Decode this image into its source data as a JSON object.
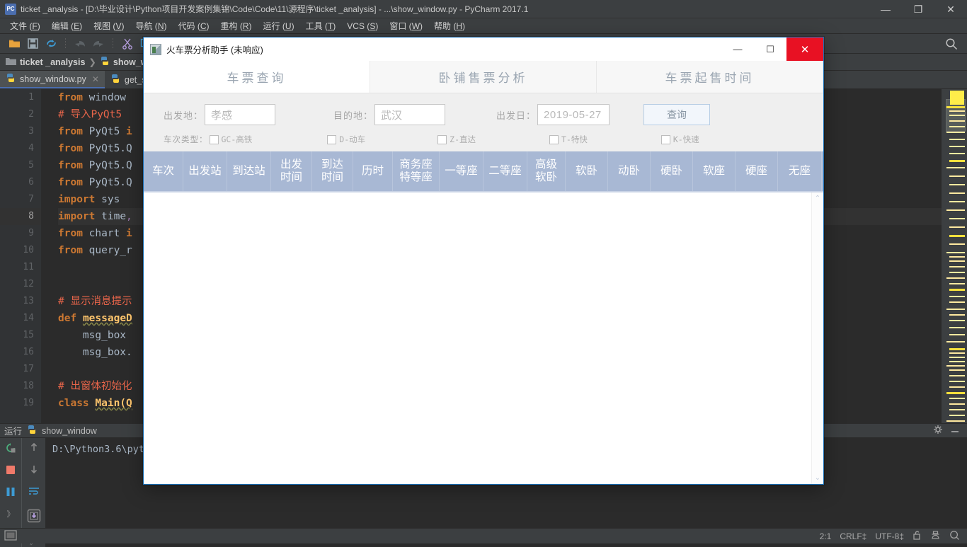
{
  "ide": {
    "titlebar": {
      "icon": "pycharm-icon",
      "title": "ticket _analysis - [D:\\毕业设计\\Python项目开发案例集锦\\Code\\Code\\11\\源程序\\ticket _analysis] - ...\\show_window.py - PyCharm 2017.1",
      "minimize": "—",
      "maximize": "❐",
      "close": "✕"
    },
    "menu": [
      {
        "label": "文件",
        "mnemonic": "F"
      },
      {
        "label": "编辑",
        "mnemonic": "E"
      },
      {
        "label": "视图",
        "mnemonic": "V"
      },
      {
        "label": "导航",
        "mnemonic": "N"
      },
      {
        "label": "代码",
        "mnemonic": "C"
      },
      {
        "label": "重构",
        "mnemonic": "R"
      },
      {
        "label": "运行",
        "mnemonic": "U"
      },
      {
        "label": "工具",
        "mnemonic": "T"
      },
      {
        "label": "VCS",
        "mnemonic": "S"
      },
      {
        "label": "窗口",
        "mnemonic": "W"
      },
      {
        "label": "帮助",
        "mnemonic": "H"
      }
    ],
    "toolbar": {
      "icons": [
        "open-folder-icon",
        "save-icon",
        "sync-icon",
        "undo-icon",
        "redo-icon",
        "cut-icon",
        "copy-icon",
        "paste-icon"
      ],
      "search_icon": "search-icon"
    },
    "breadcrumb": {
      "project": "ticket _analysis",
      "separator": "❯",
      "file": "show_wi"
    },
    "editor_tabs": [
      {
        "label": "show_window.py",
        "active": true,
        "close": "✕"
      },
      {
        "label": "get_s",
        "active": false,
        "close": ""
      }
    ],
    "code_lines": [
      {
        "n": "1",
        "html": "<span class='kw'>from</span> <span class='id'>window</span>"
      },
      {
        "n": "2",
        "html": "<span class='cmt2'># 导入PyQt5</span>"
      },
      {
        "n": "3",
        "html": "<span class='kw'>from</span> <span class='id'>PyQt5</span> <span class='kw'>i</span>"
      },
      {
        "n": "4",
        "html": "<span class='kw'>from</span> <span class='id'>PyQt5.Q</span>"
      },
      {
        "n": "5",
        "html": "<span class='kw'>from</span> <span class='id'>PyQt5.Q</span>"
      },
      {
        "n": "6",
        "html": "<span class='kw'>from</span> <span class='id'>PyQt5.Q</span>"
      },
      {
        "n": "7",
        "html": "<span class='kw'>import</span> <span class='id'>sys</span>"
      },
      {
        "n": "8",
        "html": "<span class='kw'>import</span> <span class='id'>time</span><span class='var'>,</span>",
        "hl": true
      },
      {
        "n": "9",
        "html": "<span class='kw'>from</span> <span class='id'>chart</span> <span class='kw'>i</span>"
      },
      {
        "n": "10",
        "html": "<span class='kw'>from</span> <span class='id'>query_r</span>"
      },
      {
        "n": "11",
        "html": ""
      },
      {
        "n": "12",
        "html": ""
      },
      {
        "n": "13",
        "html": "<span class='cmt2'># 显示消息提示</span>"
      },
      {
        "n": "14",
        "html": "<span class='kw'>def</span> <span class='fn'>messageD</span>"
      },
      {
        "n": "15",
        "html": "    <span class='id'>msg_box</span>"
      },
      {
        "n": "16",
        "html": "    <span class='id'>msg_box.</span>"
      },
      {
        "n": "17",
        "html": ""
      },
      {
        "n": "18",
        "html": "<span class='cmt2'># 出窗体初始化</span>"
      },
      {
        "n": "19",
        "html": "<span class='kw'>class</span> <span class='fn'>Main(Q</span>"
      }
    ],
    "run_window": {
      "label": "运行",
      "config_name": "show_window",
      "console_text": "D:\\Python3.6\\pyt",
      "side_icons": [
        "rerun-icon",
        "stop-icon",
        "pause-icon",
        "expand-all-icon",
        "scroll-up-icon",
        "scroll-down-icon",
        "soft-wrap-icon",
        "print-icon"
      ],
      "gear_icon": "gear-icon",
      "minimize_icon": "minimize-icon",
      "expand_left": "》",
      "expand_right": "》"
    },
    "statusbar": {
      "left_icon": "window-layout-icon",
      "caret": "2:1",
      "line_sep": "CRLF‡",
      "encoding": "UTF-8‡",
      "lock_icon": "unlock-icon",
      "inspector_icon": "inspector-icon",
      "search_icon": "magnifier-icon"
    }
  },
  "dialog": {
    "title": "火车票分析助手 (未响应)",
    "title_icon": "app-icon",
    "controls": {
      "minimize": "—",
      "maximize": "☐",
      "close": "✕"
    },
    "tabs": [
      {
        "label": "车票查询",
        "active": true
      },
      {
        "label": "卧铺售票分析",
        "active": false
      },
      {
        "label": "车票起售时间",
        "active": false
      }
    ],
    "form": {
      "origin_label": "出发地：",
      "origin_value": "孝感",
      "destination_label": "目的地：",
      "destination_value": "武汉",
      "date_label": "出发日：",
      "date_value": "2019-05-27",
      "query_button": "查询",
      "train_type_label": "车次类型：",
      "train_types": [
        {
          "label": "GC-高铁",
          "checked": false
        },
        {
          "label": "D-动车",
          "checked": false
        },
        {
          "label": "Z-直达",
          "checked": false
        },
        {
          "label": "T-特快",
          "checked": false
        },
        {
          "label": "K-快速",
          "checked": false
        }
      ]
    },
    "table": {
      "headers": [
        {
          "label": "车次",
          "width": 56
        },
        {
          "label": "出发站",
          "width": 62
        },
        {
          "label": "到达站",
          "width": 62
        },
        {
          "label": "出发\n时间",
          "width": 58
        },
        {
          "label": "到达\n时间",
          "width": 58
        },
        {
          "label": "历时",
          "width": 56
        },
        {
          "label": "商务座\n特等座",
          "width": 66
        },
        {
          "label": "一等座",
          "width": 62
        },
        {
          "label": "二等座",
          "width": 62
        },
        {
          "label": "高级\n软卧",
          "width": 54
        },
        {
          "label": "软卧",
          "width": 60
        },
        {
          "label": "动卧",
          "width": 60
        },
        {
          "label": "硬卧",
          "width": 60
        },
        {
          "label": "软座",
          "width": 60
        },
        {
          "label": "硬座",
          "width": 60
        },
        {
          "label": "无座",
          "width": 62
        }
      ],
      "rows": [],
      "scrollbar": {
        "up": "⌃",
        "down": "⌄"
      },
      "header_color": "#a8b8d4"
    }
  },
  "colors": {
    "accent": "#4b6eaf",
    "close_red": "#e81123",
    "table_header": "#a8b8d4",
    "ide_bg": "#3c3f41",
    "editor_bg": "#2b2b2b"
  }
}
